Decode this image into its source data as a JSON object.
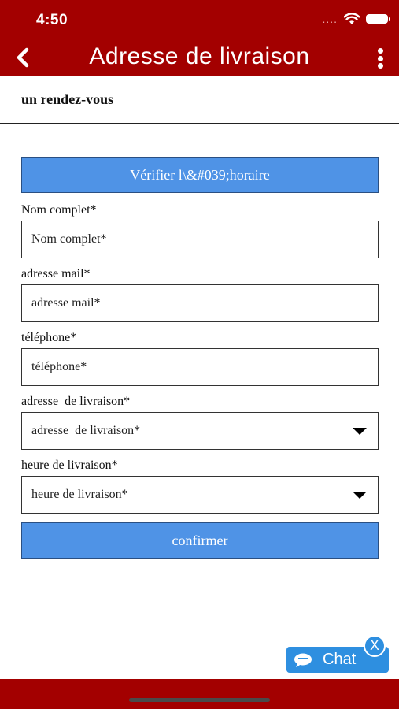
{
  "status_bar": {
    "time": "4:50",
    "signal_dots": "...."
  },
  "header": {
    "title": "Adresse de livraison",
    "back_icon": "chevron-left-icon",
    "menu_icon": "more-vertical-icon"
  },
  "section": {
    "title": "un rendez-vous"
  },
  "check_button": {
    "label": "Vérifier l\\&#039;horaire"
  },
  "form": {
    "full_name": {
      "label": "Nom complet*",
      "placeholder": "Nom complet*"
    },
    "email": {
      "label": "adresse mail*",
      "placeholder": "adresse mail*"
    },
    "phone": {
      "label": "téléphone*",
      "placeholder": "téléphone*"
    },
    "delivery_address": {
      "label": "adresse  de livraison*",
      "selected": "adresse  de livraison*"
    },
    "delivery_time": {
      "label": "heure de livraison*",
      "selected": "heure de livraison*"
    }
  },
  "confirm_button": {
    "label": "confirmer"
  },
  "chat_widget": {
    "label": "Chat",
    "close_symbol": "X"
  },
  "colors": {
    "brand_red": "#a30000",
    "button_blue": "#4f93e6",
    "chat_blue": "#2e8fe0"
  }
}
